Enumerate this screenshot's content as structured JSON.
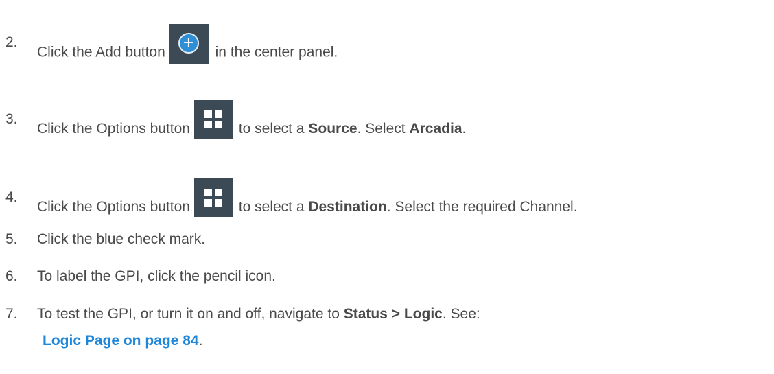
{
  "steps": [
    {
      "number": "2.",
      "text_before": "Click the Add button",
      "icon": "add-circle-icon",
      "text_after": "in the center panel."
    },
    {
      "number": "3.",
      "text_before": "Click the Options button",
      "icon": "options-grid-icon",
      "text_after": "to select a",
      "bold1": "Source",
      "text_mid": ". Select",
      "bold2": "Arcadia",
      "text_end": "."
    },
    {
      "number": "4.",
      "text_before": "Click the Options button",
      "icon": "options-grid-icon",
      "text_after": "to select a",
      "bold1": "Destination",
      "text_mid": ". Select the required Channel."
    },
    {
      "number": "5.",
      "text": "Click the blue check mark."
    },
    {
      "number": "6.",
      "text": "To label the GPI, click the pencil icon."
    },
    {
      "number": "7.",
      "text_before": "To test the GPI, or turn it on and off, navigate to",
      "bold1": "Status > Logic",
      "text_mid": ". See:",
      "link": "Logic Page on page 84",
      "text_end": "."
    }
  ],
  "colors": {
    "text": "#4a4a4a",
    "link": "#1e86d9",
    "icon_bg": "#3c4a55",
    "add_circle": "#2f8fd6"
  }
}
